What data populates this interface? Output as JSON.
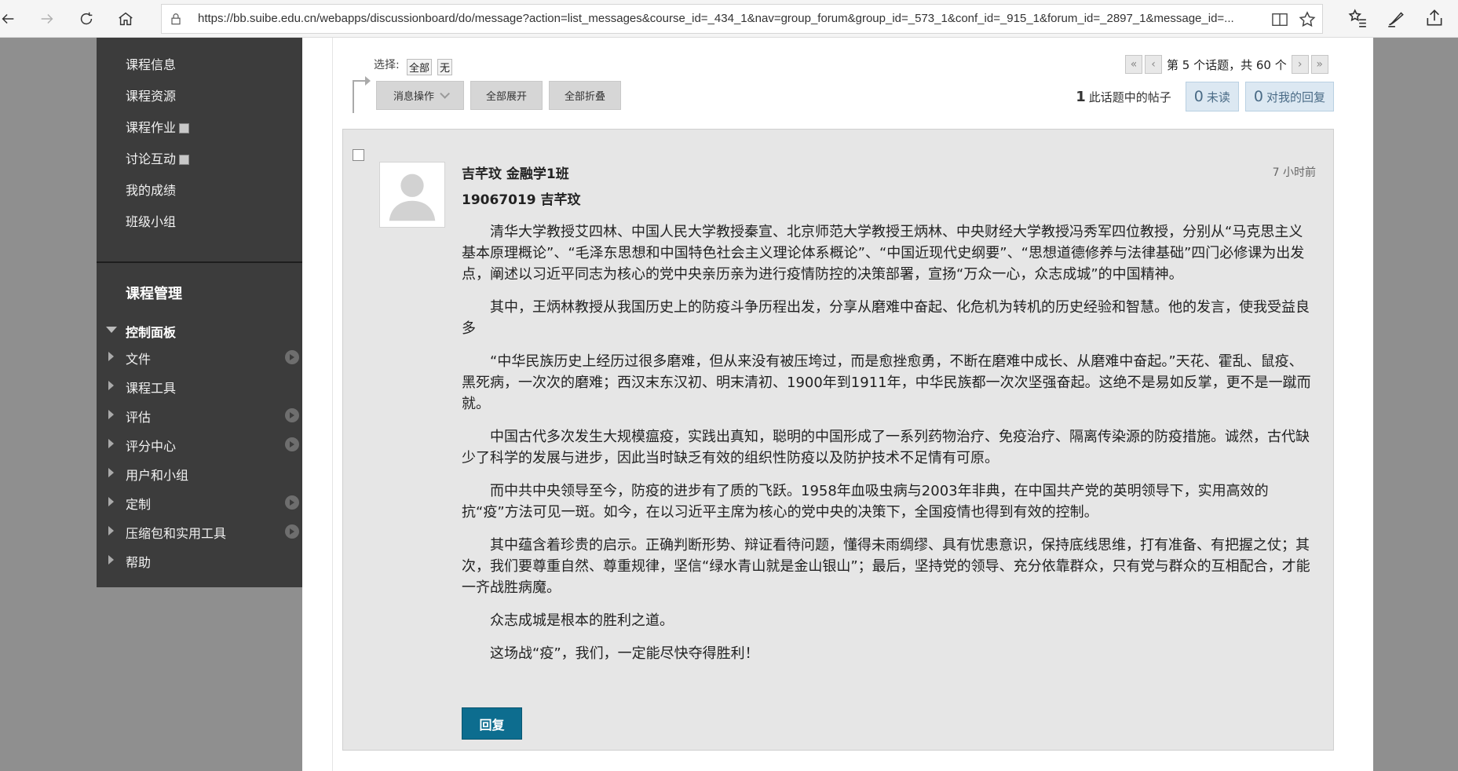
{
  "browser": {
    "url": "https://bb.suibe.edu.cn/webapps/discussionboard/do/message?action=list_messages&course_id=_434_1&nav=group_forum&group_id=_573_1&conf_id=_915_1&forum_id=_2897_1&message_id=..."
  },
  "sidebar": {
    "items": [
      {
        "label": "课程信息"
      },
      {
        "label": "课程资源"
      },
      {
        "label": "课程作业"
      },
      {
        "label": "讨论互动"
      },
      {
        "label": "我的成绩"
      },
      {
        "label": "班级小组"
      }
    ],
    "heading": "课程管理",
    "control_panel": {
      "title": "控制面板",
      "items": [
        {
          "label": "文件"
        },
        {
          "label": "课程工具"
        },
        {
          "label": "评估"
        },
        {
          "label": "评分中心"
        },
        {
          "label": "用户和小组"
        },
        {
          "label": "定制"
        },
        {
          "label": "压缩包和实用工具"
        },
        {
          "label": "帮助"
        }
      ]
    }
  },
  "toolbar": {
    "select_label": "选择:",
    "select_all": "全部",
    "select_none": "无",
    "message_actions": "消息操作",
    "expand_all": "全部展开",
    "collapse_all": "全部折叠"
  },
  "pager": {
    "text": "第 5 个话题，共 60 个"
  },
  "stats": {
    "posts_count": "1",
    "posts_label": "此话题中的帖子",
    "unread_count": "0",
    "unread_label": "未读",
    "replies_count": "0",
    "replies_label": "对我的回复"
  },
  "post": {
    "author": "吉芊玟 金融学1班",
    "subtitle": "19067019 吉芊玟",
    "time": "7 小时前",
    "paragraphs": [
      "清华大学教授艾四林、中国人民大学教授秦宣、北京师范大学教授王炳林、中央财经大学教授冯秀军四位教授，分别从“马克思主义基本原理概论”、“毛泽东思想和中国特色社会主义理论体系概论”、“中国近现代史纲要”、“思想道德修养与法律基础”四门必修课为出发点，阐述以习近平同志为核心的党中央亲历亲为进行疫情防控的决策部署，宣扬“万众一心，众志成城”的中国精神。",
      "其中，王炳林教授从我国历史上的防疫斗争历程出发，分享从磨难中奋起、化危机为转机的历史经验和智慧。他的发言，使我受益良多",
      "“中华民族历史上经历过很多磨难，但从来没有被压垮过，而是愈挫愈勇，不断在磨难中成长、从磨难中奋起。”天花、霍乱、鼠疫、黑死病，一次次的磨难；西汉末东汉初、明末清初、1900年到1911年，中华民族都一次次坚强奋起。这绝不是易如反掌，更不是一蹴而就。",
      "中国古代多次发生大规模瘟疫，实践出真知，聪明的中国形成了一系列药物治疗、免疫治疗、隔离传染源的防疫措施。诚然，古代缺少了科学的发展与进步，因此当时缺乏有效的组织性防疫以及防护技术不足情有可原。",
      "而中共中央领导至今，防疫的进步有了质的飞跃。1958年血吸虫病与2003年非典，在中国共产党的英明领导下，实用高效的抗“疫”方法可见一斑。如今，在以习近平主席为核心的党中央的决策下，全国疫情也得到有效的控制。",
      "其中蕴含着珍贵的启示。正确判断形势、辩证看待问题，懂得未雨绸缪、具有忧患意识，保持底线思维，打有准备、有把握之仗；其次，我们要尊重自然、尊重规律，坚信“绿水青山就是金山银山”；最后，坚持党的领导、充分依靠群众，只有党与群众的互相配合，才能一齐战胜病魔。",
      "众志成城是根本的胜利之道。",
      "这场战“疫”，我们，一定能尽快夺得胜利！"
    ],
    "reply_label": "回复"
  }
}
